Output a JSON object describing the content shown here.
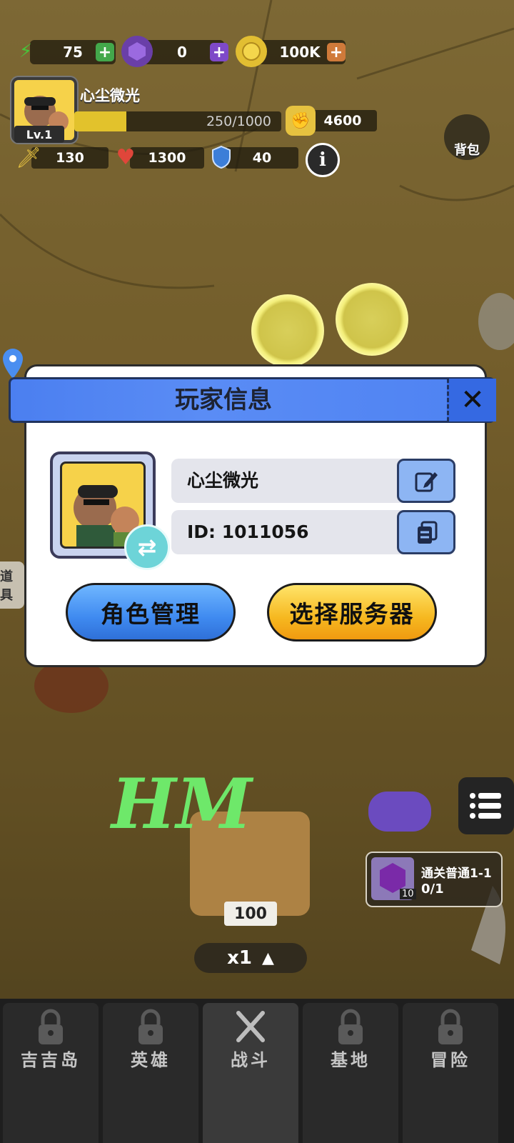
{
  "resources": {
    "energy": {
      "value": "75",
      "icon": "lightning-icon"
    },
    "gems": {
      "value": "0",
      "icon": "gem-icon"
    },
    "coins": {
      "value": "100K",
      "icon": "coin-icon"
    }
  },
  "player": {
    "name": "心尘微光",
    "level": "Lv.1",
    "exp": "250/1000",
    "exp_fraction": 0.25,
    "power": "4600"
  },
  "stats": {
    "attack": "130",
    "hp": "1300",
    "defense": "40"
  },
  "bag_label": "背包",
  "info_label": "i",
  "modal": {
    "title": "玩家信息",
    "close": "✕",
    "name": "心尘微光",
    "id": "ID: 1011056",
    "role_button": "角色管理",
    "server_button": "选择服务器"
  },
  "side_tab": "道具",
  "quest": {
    "title": "通关普通1-1",
    "progress": "0/1",
    "reward_count": "10"
  },
  "box_count": "100",
  "speed": {
    "label": "x1",
    "arrow": "▲"
  },
  "watermark": "HM",
  "nav": [
    "吉吉岛",
    "英雄",
    "战斗",
    "基地",
    "冒险"
  ],
  "colors": {
    "modal_header": "#4b7ff0",
    "role_button": "#3f8af0",
    "server_button": "#f6b820",
    "accent_green": "#6ee86a"
  }
}
